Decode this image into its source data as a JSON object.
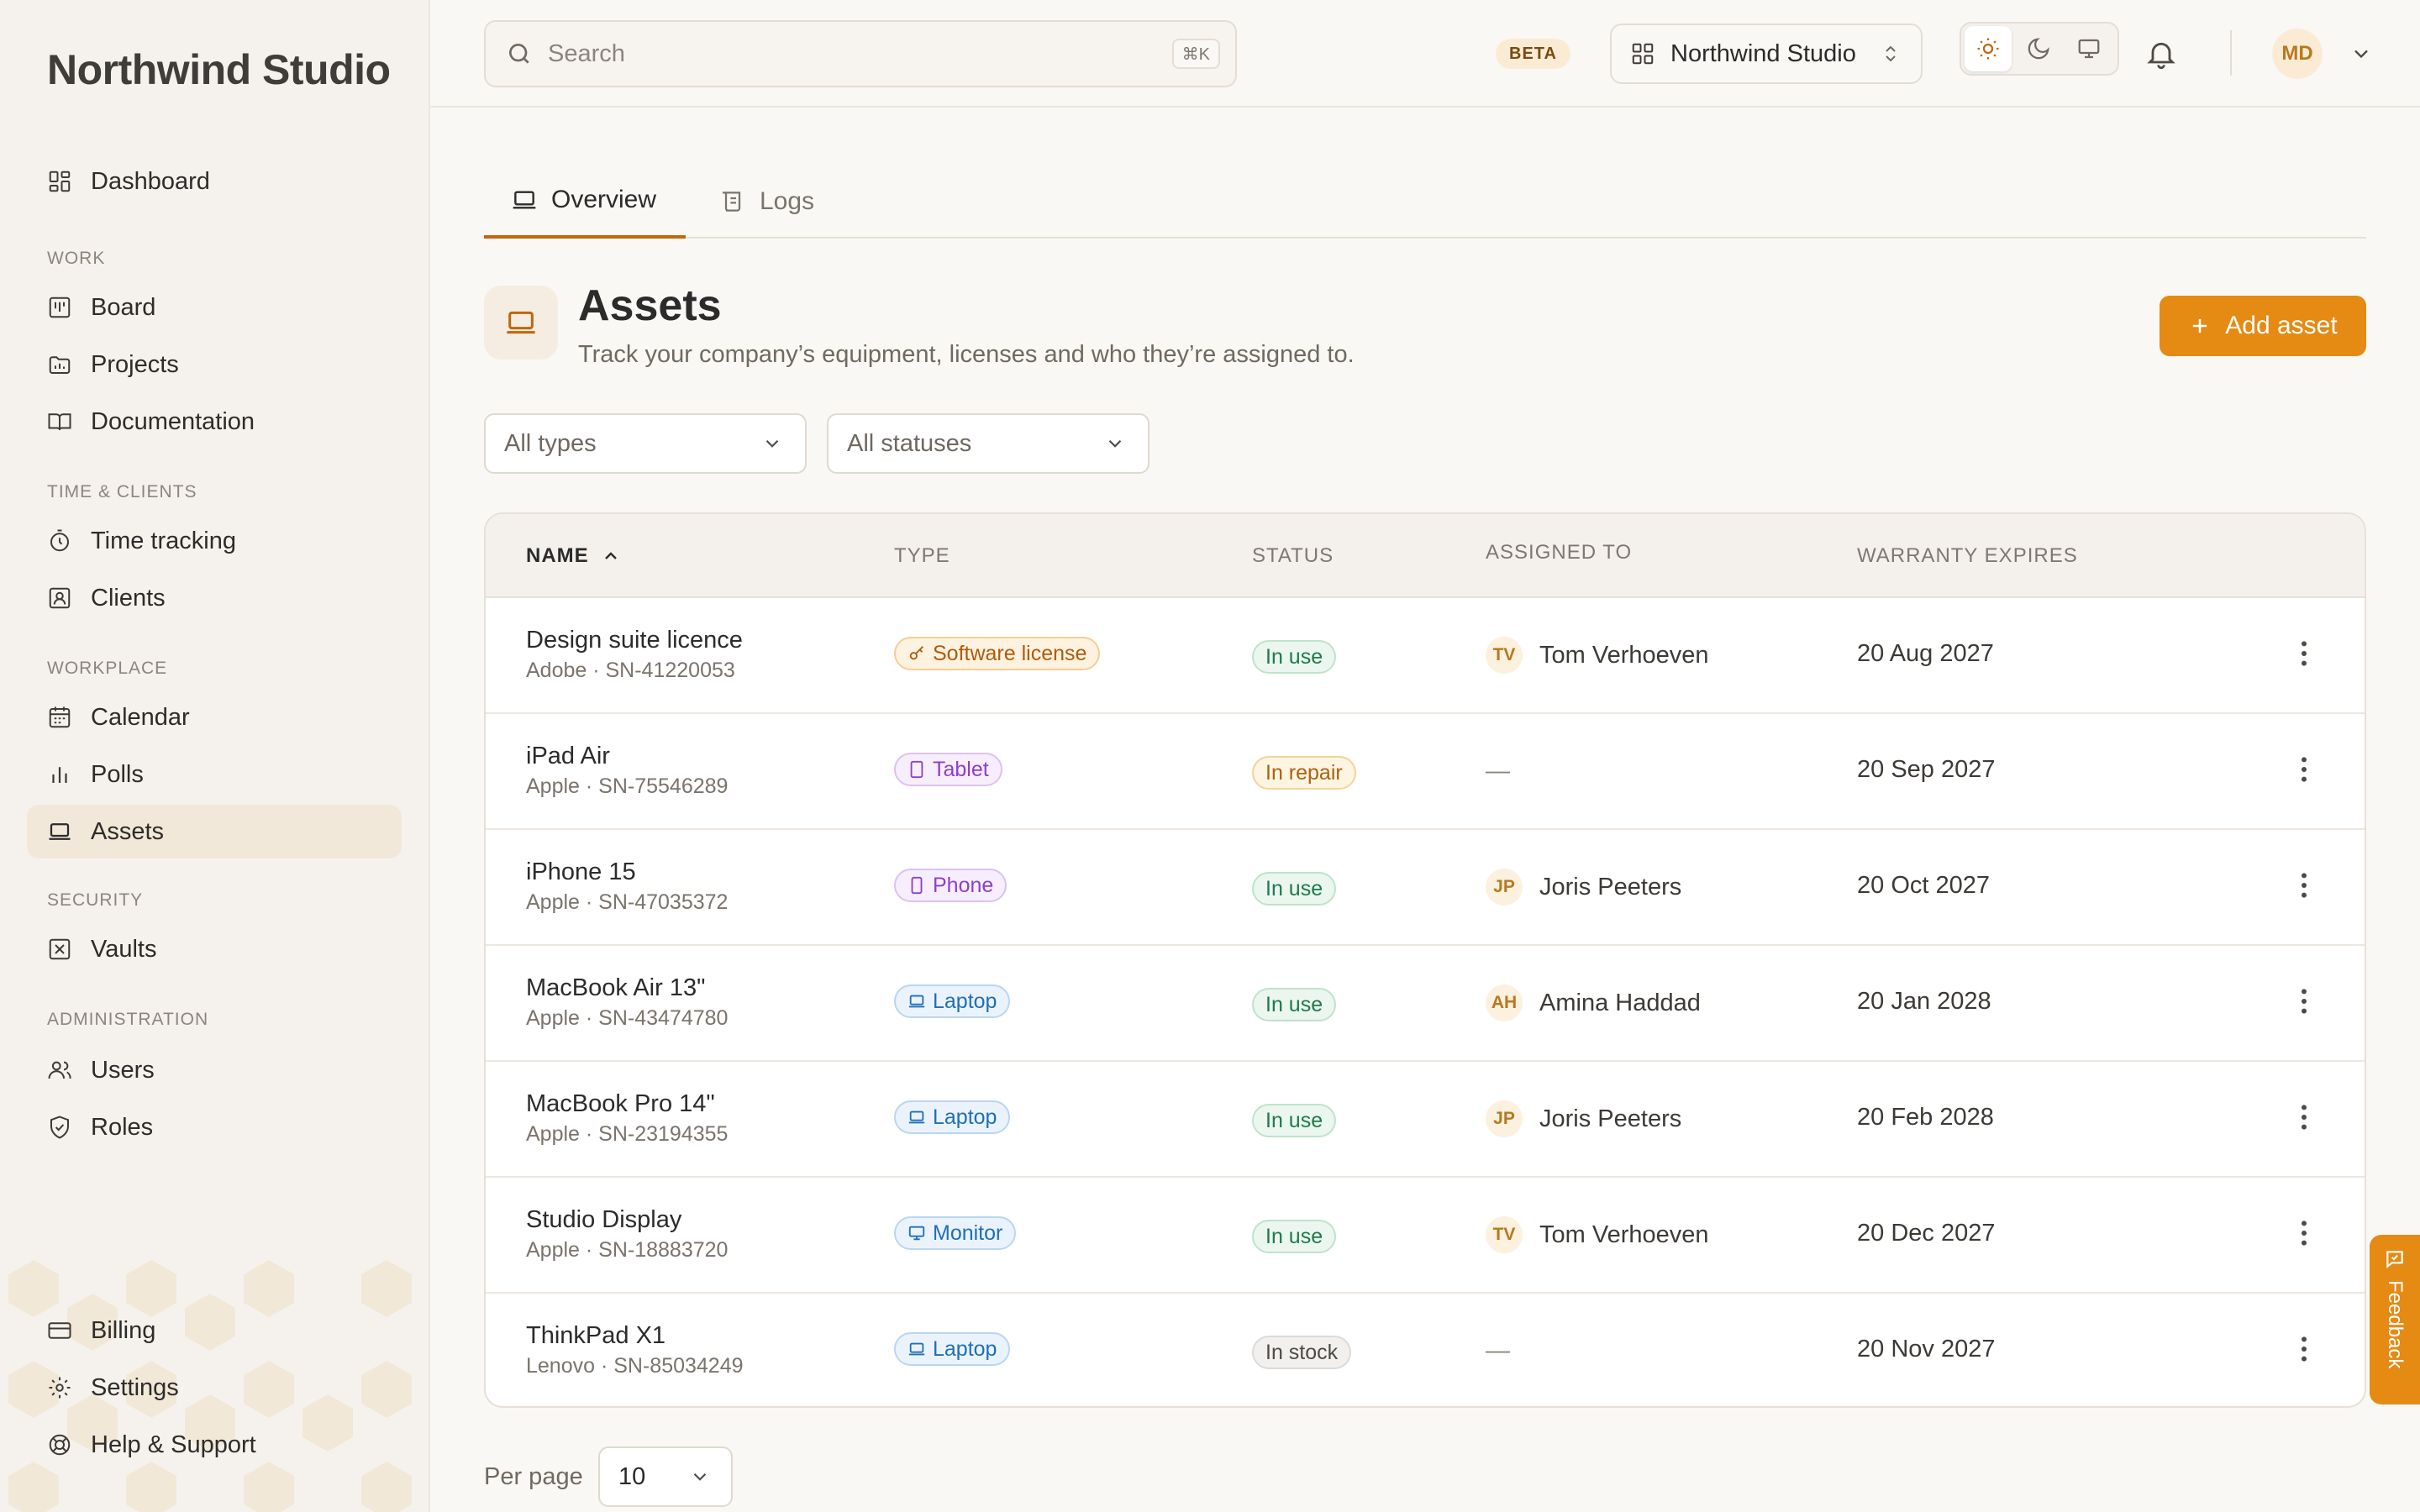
{
  "app": {
    "brand": "Northwind Studio"
  },
  "sidebar": {
    "dashboard": "Dashboard",
    "sections": {
      "work": "WORK",
      "time_clients": "TIME & CLIENTS",
      "workplace": "WORKPLACE",
      "security": "SECURITY",
      "administration": "ADMINISTRATION"
    },
    "items": {
      "board": "Board",
      "projects": "Projects",
      "documentation": "Documentation",
      "time_tracking": "Time tracking",
      "clients": "Clients",
      "calendar": "Calendar",
      "polls": "Polls",
      "assets": "Assets",
      "vaults": "Vaults",
      "users": "Users",
      "roles": "Roles"
    },
    "footer": {
      "billing": "Billing",
      "settings": "Settings",
      "help": "Help & Support"
    },
    "active": "assets"
  },
  "topbar": {
    "search_placeholder": "Search",
    "search_shortcut": "⌘K",
    "beta": "BETA",
    "workspace": "Northwind Studio",
    "theme_active": "light",
    "user_initials": "MD"
  },
  "tabs": {
    "overview": "Overview",
    "logs": "Logs",
    "active": "overview"
  },
  "page": {
    "title": "Assets",
    "subtitle": "Track your company’s equipment, licenses and who they’re assigned to.",
    "add_button": "Add asset"
  },
  "filters": {
    "type": "All types",
    "status": "All statuses"
  },
  "table": {
    "headers": {
      "name": "NAME",
      "type": "TYPE",
      "status": "STATUS",
      "assigned": "ASSIGNED TO",
      "warranty": "WARRANTY EXPIRES"
    },
    "sort": {
      "column": "name",
      "direction": "ascending"
    },
    "rows": [
      {
        "name": "Design suite licence",
        "sub": "Adobe · SN-41220053",
        "type": "Software license",
        "status": "In use",
        "initials": "TV",
        "assignee": "Tom Verhoeven",
        "warranty": "20 Aug 2027"
      },
      {
        "name": "iPad Air",
        "sub": "Apple · SN-75546289",
        "type": "Tablet",
        "status": "In repair",
        "initials": "",
        "assignee": "—",
        "warranty": "20 Sep 2027"
      },
      {
        "name": "iPhone 15",
        "sub": "Apple · SN-47035372",
        "type": "Phone",
        "status": "In use",
        "initials": "JP",
        "assignee": "Joris Peeters",
        "warranty": "20 Oct 2027"
      },
      {
        "name": "MacBook Air 13\"",
        "sub": "Apple · SN-43474780",
        "type": "Laptop",
        "status": "In use",
        "initials": "AH",
        "assignee": "Amina Haddad",
        "warranty": "20 Jan 2028"
      },
      {
        "name": "MacBook Pro 14\"",
        "sub": "Apple · SN-23194355",
        "type": "Laptop",
        "status": "In use",
        "initials": "JP",
        "assignee": "Joris Peeters",
        "warranty": "20 Feb 2028"
      },
      {
        "name": "Studio Display",
        "sub": "Apple · SN-18883720",
        "type": "Monitor",
        "status": "In use",
        "initials": "TV",
        "assignee": "Tom Verhoeven",
        "warranty": "20 Dec 2027"
      },
      {
        "name": "ThinkPad X1",
        "sub": "Lenovo · SN-85034249",
        "type": "Laptop",
        "status": "In stock",
        "initials": "",
        "assignee": "—",
        "warranty": "20 Nov 2027"
      }
    ]
  },
  "pagination": {
    "per_page_label": "Per page",
    "per_page_value": "10"
  },
  "feedback": {
    "label": "Feedback"
  },
  "colors": {
    "accent": "#e58a12",
    "type_license": "#c2660d",
    "type_tablet": "#8e3fc7",
    "type_laptop": "#1f6fb8",
    "status_in_use": "#1f7a4a",
    "status_in_repair": "#a9620f",
    "status_in_stock": "#4f4a44"
  }
}
